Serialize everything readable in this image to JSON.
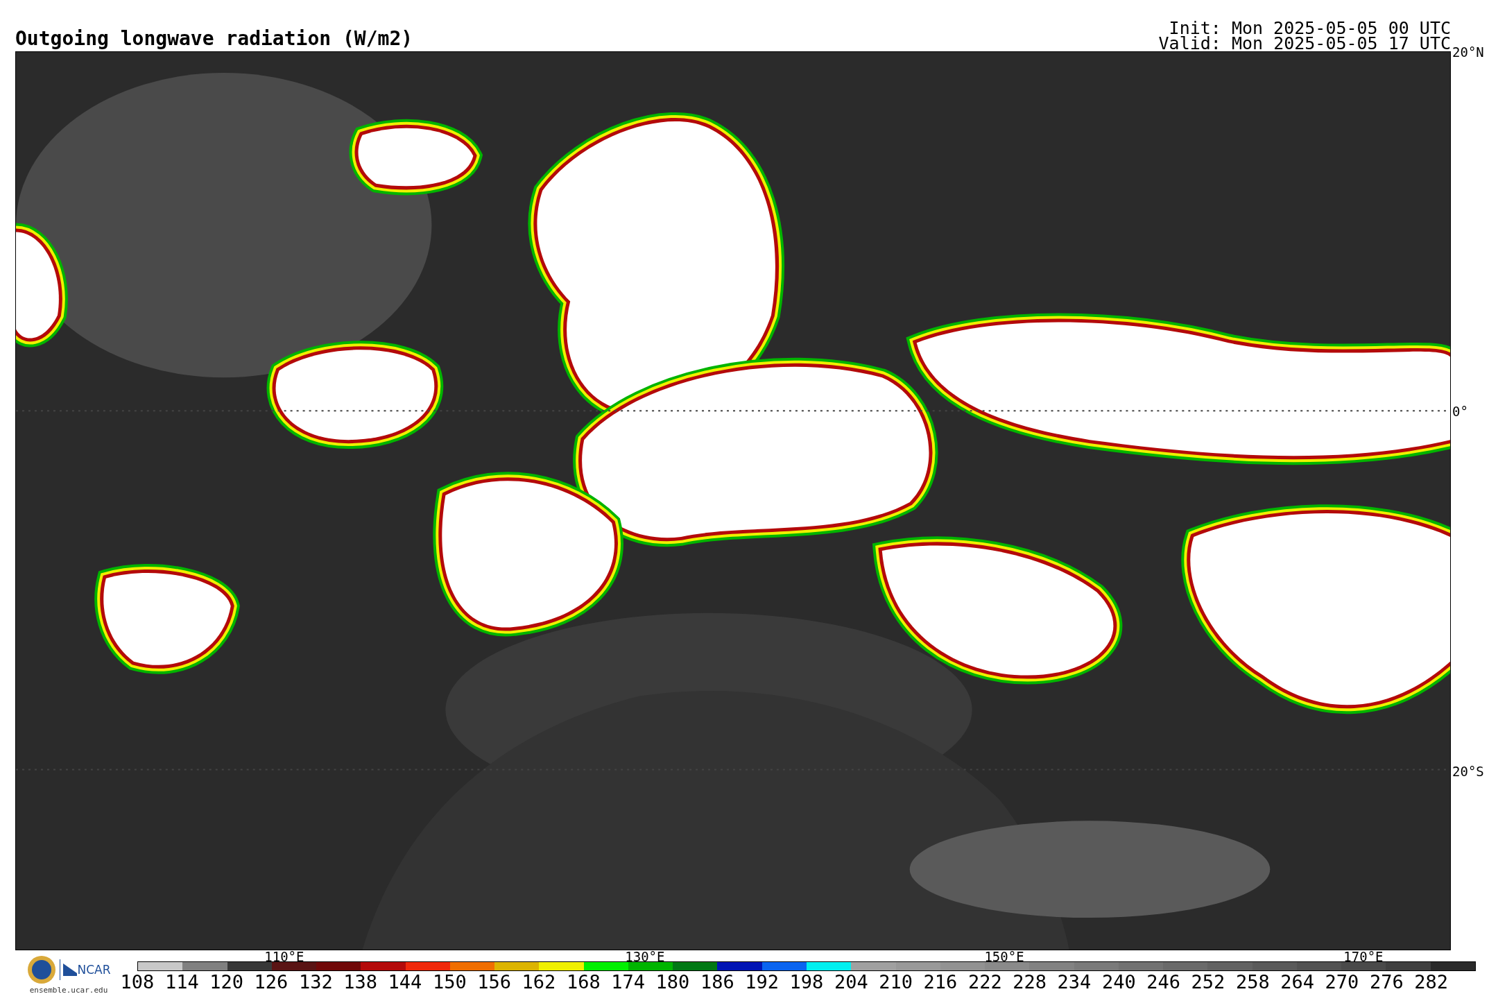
{
  "title": "Outgoing longwave radiation (W/m2)",
  "init": "Init: Mon 2025-05-05 00 UTC",
  "valid": "Valid: Mon 2025-05-05 17 UTC",
  "map": {
    "lat_labels": [
      "20°N",
      "0°",
      "20°S"
    ],
    "lon_labels": [
      "110°E",
      "130°E",
      "150°E",
      "170°E"
    ]
  },
  "logos": {
    "ncar": "NCAR",
    "site": "ensemble.ucar.edu"
  },
  "colorbar": [
    {
      "label": "108",
      "color": "#c8c8c8"
    },
    {
      "label": "114",
      "color": "#808080"
    },
    {
      "label": "120",
      "color": "#383838"
    },
    {
      "label": "126",
      "color": "#5a1414"
    },
    {
      "label": "132",
      "color": "#700808"
    },
    {
      "label": "138",
      "color": "#b40a0a"
    },
    {
      "label": "144",
      "color": "#f0280a"
    },
    {
      "label": "150",
      "color": "#f06e00"
    },
    {
      "label": "156",
      "color": "#dcb400"
    },
    {
      "label": "162",
      "color": "#f0f000"
    },
    {
      "label": "168",
      "color": "#00f000"
    },
    {
      "label": "174",
      "color": "#00b400"
    },
    {
      "label": "180",
      "color": "#007814"
    },
    {
      "label": "186",
      "color": "#0014b4"
    },
    {
      "label": "192",
      "color": "#0a64f0"
    },
    {
      "label": "198",
      "color": "#00f0f0"
    },
    {
      "label": "204",
      "color": "#a0a0a0"
    },
    {
      "label": "210",
      "color": "#999999"
    },
    {
      "label": "216",
      "color": "#929292"
    },
    {
      "label": "222",
      "color": "#8a8a8a"
    },
    {
      "label": "228",
      "color": "#828282"
    },
    {
      "label": "234",
      "color": "#7a7a7a"
    },
    {
      "label": "240",
      "color": "#727272"
    },
    {
      "label": "246",
      "color": "#6a6a6a"
    },
    {
      "label": "252",
      "color": "#626262"
    },
    {
      "label": "258",
      "color": "#5a5a5a"
    },
    {
      "label": "264",
      "color": "#525252"
    },
    {
      "label": "270",
      "color": "#4a4a4a"
    },
    {
      "label": "276",
      "color": "#404040"
    },
    {
      "label": "282",
      "color": "#2a2a2a"
    }
  ]
}
